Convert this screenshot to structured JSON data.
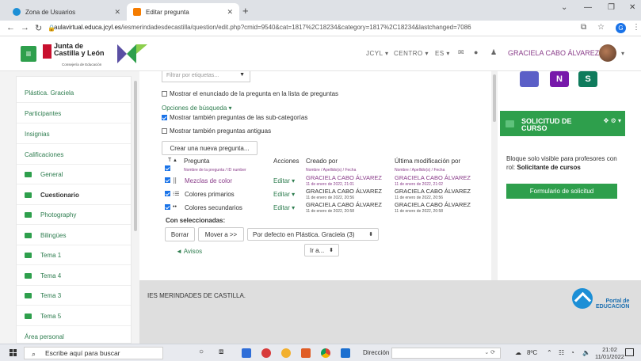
{
  "browser": {
    "tabs": [
      {
        "label": "Zona de Usuarios",
        "favicon_color": "#1c8fd6"
      },
      {
        "label": "Editar pregunta",
        "favicon_color": "#f57c00"
      }
    ],
    "new_tab": "+",
    "window_controls": {
      "menu": "⌄",
      "minimize": "—",
      "restore": "❐",
      "close": "✕"
    },
    "nav": {
      "back": "←",
      "forward": "→",
      "reload": "↻"
    },
    "url_domain": "aulavirtual.educa.jcyl.es",
    "url_path": "/iesmerindadesdecastilla/question/edit.php?cmid=9540&cat=1817%2C18234&category=1817%2C18234&lastchanged=7086",
    "profile_initial": "G"
  },
  "header": {
    "brand_line1": "Junta de",
    "brand_line2": "Castilla y León",
    "brand_sub": "Consejería de Educación",
    "nav_items": [
      "JCYL ▾",
      "CENTRO ▾",
      "ES ▾"
    ],
    "user_name": "GRACIELA CABO ÁLVAREZ"
  },
  "sidebar": {
    "items": [
      {
        "label": "Plástica. Graciela",
        "folder": false
      },
      {
        "label": "Participantes",
        "folder": false
      },
      {
        "label": "Insignias",
        "folder": false
      },
      {
        "label": "Calificaciones",
        "folder": false
      },
      {
        "label": "General",
        "folder": true
      },
      {
        "label": "Cuestionario",
        "folder": true,
        "bold": true
      },
      {
        "label": "Photography",
        "folder": true
      },
      {
        "label": "Bilingües",
        "folder": true
      },
      {
        "label": "Tema 1",
        "folder": true
      },
      {
        "label": "Tema 4",
        "folder": true
      },
      {
        "label": "Tema 3",
        "folder": true
      },
      {
        "label": "Tema 5",
        "folder": true
      }
    ],
    "area_personal": "Área personal"
  },
  "main": {
    "filter_placeholder": "Filtrar por etiquetas...",
    "show_text_label": "Mostrar el enunciado de la pregunta en la lista de preguntas",
    "search_options": "Opciones de búsqueda ▾",
    "subcat_label": "Mostrar también preguntas de las sub-categorías",
    "old_label": "Mostrar también preguntas antiguas",
    "create_button": "Crear una nueva pregunta...",
    "col_type": "T",
    "col_question": "Pregunta",
    "col_question_sub": "Nombre de la pregunta / ID number",
    "col_actions": "Acciones",
    "col_created": "Creado por",
    "col_created_sub": "Nombre / Apellido(s) / Fecha",
    "col_modified": "Última modificación por",
    "col_modified_sub": "Nombre / Apellido(s) / Fecha",
    "rows": [
      {
        "icon": "⣿",
        "name": "Mezclas de color",
        "edit": "Editar ▾",
        "created_by": "GRACIELA CABO ÁLVAREZ",
        "created_date": "11 de enero de 2022, 21:01",
        "modified_by": "GRACIELA CABO ÁLVAREZ",
        "modified_date": "11 de enero de 2022, 21:02"
      },
      {
        "icon": "⁝☰",
        "name": "Colores primarios",
        "edit": "Editar ▾",
        "created_by": "GRACIELA CABO ÁLVAREZ",
        "created_date": "11 de enero de 2022, 20:56",
        "modified_by": "GRACIELA CABO ÁLVAREZ",
        "modified_date": "11 de enero de 2022, 20:56"
      },
      {
        "icon": "••",
        "name": "Colores secundarios",
        "edit": "Editar ▾",
        "created_by": "GRACIELA CABO ÁLVAREZ",
        "created_date": "11 de enero de 2022, 20:58",
        "modified_by": "GRACIELA CABO ÁLVAREZ",
        "modified_date": "11 de enero de 2022, 20:58"
      }
    ],
    "with_selected": "Con seleccionadas:",
    "delete_button": "Borrar",
    "move_button": "Mover a >>",
    "category_select": "Por defecto en Plástica. Graciela (3)",
    "avisos_link": "◄ Avisos",
    "goto_select": "Ir a..."
  },
  "right": {
    "app_icons": [
      {
        "letter": "",
        "color": "#5b5fc7"
      },
      {
        "letter": "N",
        "color": "#7719aa"
      },
      {
        "letter": "S",
        "color": "#0f7b5c"
      }
    ],
    "block_title_1": "SOLICITUD DE",
    "block_title_2": "CURSO",
    "block_controls": "✥ ⚙ ▾",
    "block_text": "Bloque solo visible para profesores con rol:",
    "block_text_bold": "Solicitante de cursos",
    "form_button": "Formulario de solicitud"
  },
  "footer": {
    "text": "IES MERINDADES DE CASTILLA.",
    "portal_line1": "Portal de",
    "portal_line2": "EDUCACIÓN"
  },
  "taskbar": {
    "search": "Escribe aquí para buscar",
    "apps": [
      {
        "color": "#333333"
      },
      {
        "color": "#555555"
      },
      {
        "color": "#2f6ed8"
      },
      {
        "color": "#d83b3b"
      },
      {
        "color": "#f2b02e"
      },
      {
        "color": "#e05d26"
      },
      {
        "color": "#f0b400"
      },
      {
        "color": "#1b6fd0"
      }
    ],
    "direccion": "Dirección",
    "weather": "8ºC",
    "time": "21:02",
    "date": "11/01/2022"
  },
  "colors": {
    "brand_green": "#2e9f4c",
    "link_purple": "#8a3d8a"
  }
}
